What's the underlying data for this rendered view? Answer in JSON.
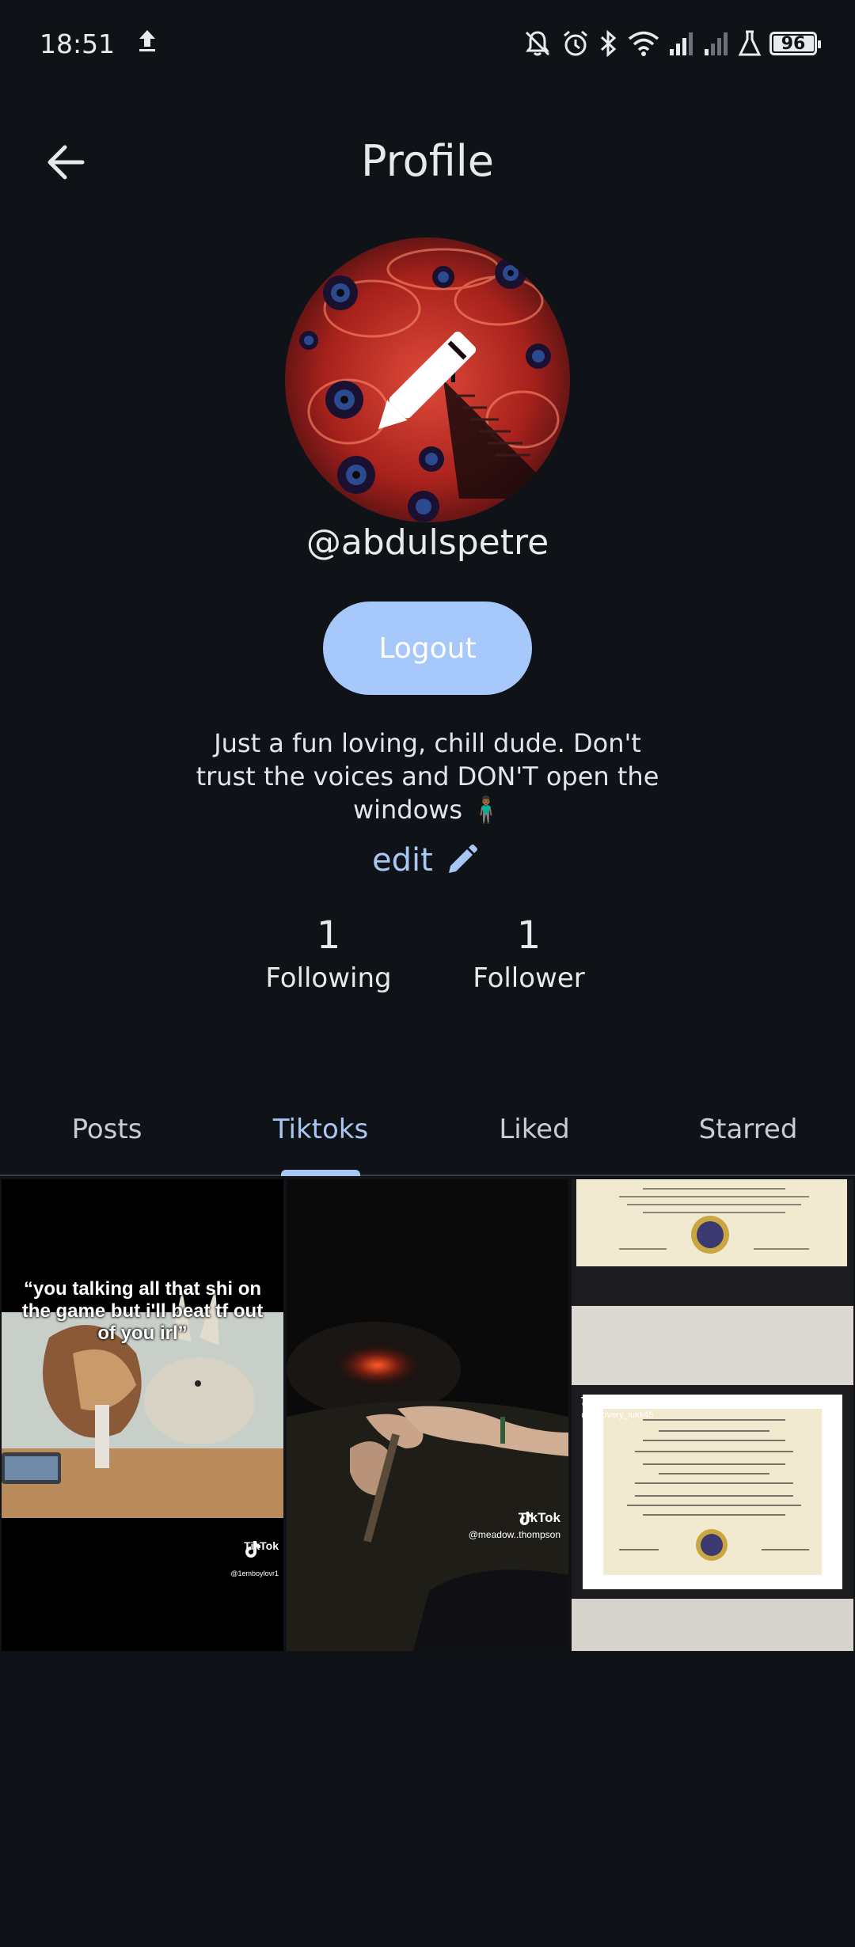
{
  "status_bar": {
    "time": "18:51",
    "battery_level": "96",
    "icons": [
      "upload-icon",
      "bell-off-icon",
      "alarm-icon",
      "bluetooth-icon",
      "wifi-icon",
      "signal-icon",
      "signal-icon",
      "lab-icon",
      "battery-icon"
    ]
  },
  "header": {
    "title": "Profile",
    "back_icon": "arrow-left-icon"
  },
  "profile": {
    "username": "@abdulspetre",
    "logout_label": "Logout",
    "bio": "Just a fun loving, chill dude. Don't trust the voices and DON'T open the windows 🧍🏾‍♂️",
    "edit_label": "edit",
    "following_count": "1",
    "following_label": "Following",
    "followers_count": "1",
    "followers_label": "Follower"
  },
  "tabs": [
    {
      "label": "Posts",
      "active": false
    },
    {
      "label": "Tiktoks",
      "active": true
    },
    {
      "label": "Liked",
      "active": false
    },
    {
      "label": "Starred",
      "active": false
    }
  ],
  "tiktoks": [
    {
      "caption": "“you talking all that shi on the game but i'll beat tf out of you irl”",
      "brand": "TikTok",
      "handle": "@1emboylovr1"
    },
    {
      "brand": "TikTok",
      "handle": "@meadow..thompson"
    },
    {
      "brand": "TikTok",
      "handle": "@recovery_lukk45"
    }
  ],
  "colors": {
    "background": "#0f1318",
    "accent": "#a9c7f5",
    "logout_button": "#a7c8fa"
  }
}
